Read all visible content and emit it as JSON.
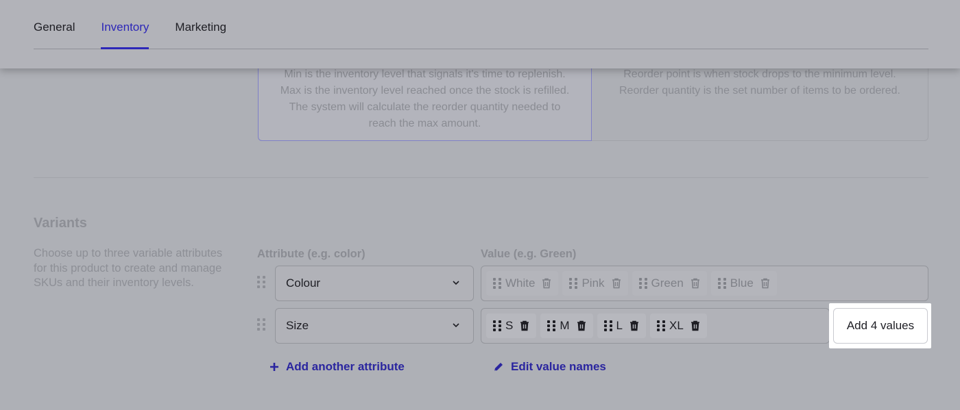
{
  "tabs": [
    {
      "label": "General",
      "active": false
    },
    {
      "label": "Inventory",
      "active": true
    },
    {
      "label": "Marketing",
      "active": false
    }
  ],
  "reorder_cards": {
    "min_max_text": "Min is the inventory level that signals it's time to replenish. Max is the inventory level reached once the stock is refilled. The system will calculate the reorder quantity needed to reach the max amount.",
    "reorder_point_text": "Reorder point is when stock drops to the minimum level. Reorder quantity is the set number of items to be ordered."
  },
  "variants": {
    "title": "Variants",
    "description": "Choose up to three variable attributes for this product to create and manage SKUs and their inventory levels.",
    "attribute_label": "Attribute (e.g. color)",
    "value_label": "Value (e.g. Green)",
    "rows": [
      {
        "attribute": "Colour",
        "values": [
          "White",
          "Pink",
          "Green",
          "Blue"
        ]
      },
      {
        "attribute": "Size",
        "values": [
          "S",
          "M",
          "L",
          "XL"
        ]
      }
    ],
    "add_values_button": "Add 4 values",
    "add_attribute_link": "Add another attribute",
    "edit_values_link": "Edit value names"
  },
  "colors": {
    "accent": "#2d27b8",
    "link": "#2a259f",
    "overlay": "#aeb0b6"
  }
}
